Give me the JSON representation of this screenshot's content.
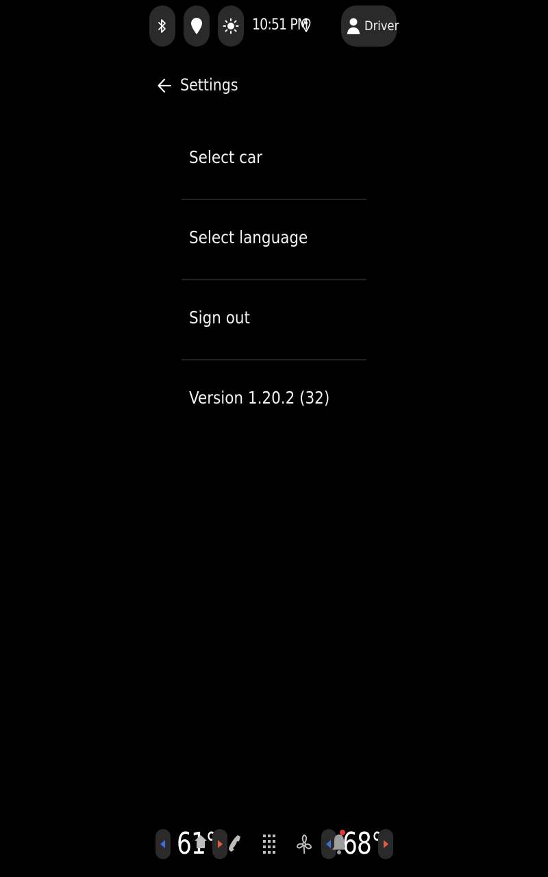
{
  "status_bar": {
    "time": "10:51 PM",
    "icons": [
      "bluetooth-icon",
      "location-icon",
      "brightness-icon",
      "location-pin-icon"
    ],
    "profile_label": "Driver"
  },
  "header": {
    "title": "Settings"
  },
  "settings": {
    "items": [
      {
        "label": "Select car"
      },
      {
        "label": "Select language"
      },
      {
        "label": "Sign out"
      },
      {
        "label": "Version 1.20.2 (32)"
      }
    ]
  },
  "bottom_bar": {
    "driver_temp": "61°",
    "passenger_temp": "68°",
    "icons": [
      "home-icon",
      "phone-icon",
      "apps-grid-icon",
      "fan-icon",
      "notification-bell-icon"
    ],
    "colors": {
      "left_arrow": "#3d6fd6",
      "right_arrow": "#e05a4f",
      "notification_dot": "#e53935"
    }
  }
}
